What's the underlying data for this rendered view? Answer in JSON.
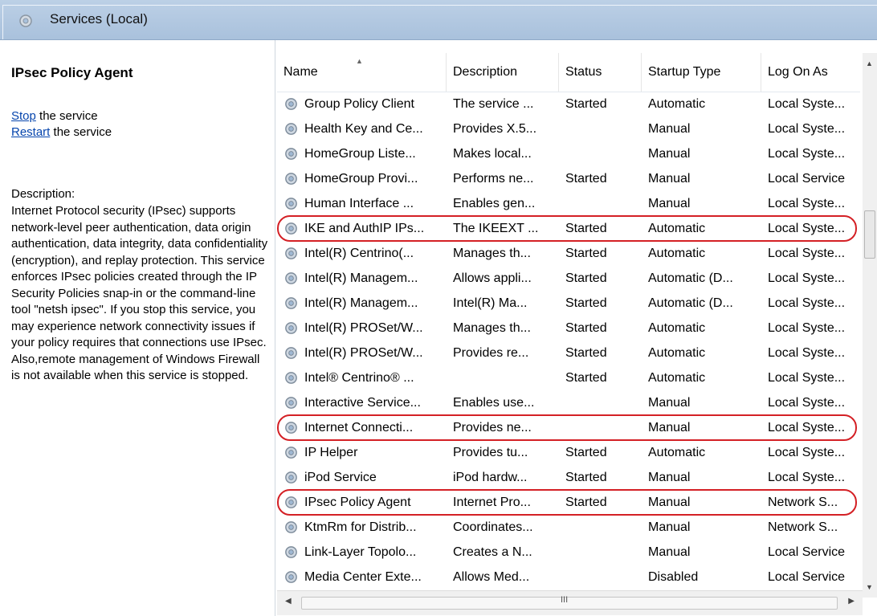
{
  "header": {
    "title": "Services (Local)",
    "icon": "gear-icon"
  },
  "left_panel": {
    "service_name": "IPsec Policy Agent",
    "stop_link": "Stop",
    "stop_suffix": " the service",
    "restart_link": "Restart",
    "restart_suffix": " the service",
    "description_label": "Description:",
    "description": "Internet Protocol security (IPsec) supports network-level peer authentication, data origin authentication, data integrity, data confidentiality (encryption), and replay protection.  This service enforces IPsec policies created through the IP Security Policies snap-in or the command-line tool \"netsh ipsec\".  If you stop this service, you may experience network connectivity issues if your policy requires that connections use IPsec.  Also,remote management of Windows Firewall is not available when this service is stopped."
  },
  "columns": [
    "Name",
    "Description",
    "Status",
    "Startup Type",
    "Log On As"
  ],
  "rows": [
    {
      "name": "Group Policy Client",
      "description": "The service ...",
      "status": "Started",
      "startup": "Automatic",
      "logon": "Local Syste...",
      "highlighted": false
    },
    {
      "name": "Health Key and Ce...",
      "description": "Provides X.5...",
      "status": "",
      "startup": "Manual",
      "logon": "Local Syste...",
      "highlighted": false
    },
    {
      "name": "HomeGroup Liste...",
      "description": "Makes local...",
      "status": "",
      "startup": "Manual",
      "logon": "Local Syste...",
      "highlighted": false
    },
    {
      "name": "HomeGroup Provi...",
      "description": "Performs ne...",
      "status": "Started",
      "startup": "Manual",
      "logon": "Local Service",
      "highlighted": false
    },
    {
      "name": "Human Interface ...",
      "description": "Enables gen...",
      "status": "",
      "startup": "Manual",
      "logon": "Local Syste...",
      "highlighted": false
    },
    {
      "name": "IKE and AuthIP IPs...",
      "description": "The IKEEXT ...",
      "status": "Started",
      "startup": "Automatic",
      "logon": "Local Syste...",
      "highlighted": true
    },
    {
      "name": "Intel(R) Centrino(...",
      "description": "Manages th...",
      "status": "Started",
      "startup": "Automatic",
      "logon": "Local Syste...",
      "highlighted": false
    },
    {
      "name": "Intel(R) Managem...",
      "description": "Allows appli...",
      "status": "Started",
      "startup": "Automatic (D...",
      "logon": "Local Syste...",
      "highlighted": false
    },
    {
      "name": "Intel(R) Managem...",
      "description": "Intel(R) Ma...",
      "status": "Started",
      "startup": "Automatic (D...",
      "logon": "Local Syste...",
      "highlighted": false
    },
    {
      "name": "Intel(R) PROSet/W...",
      "description": "Manages th...",
      "status": "Started",
      "startup": "Automatic",
      "logon": "Local Syste...",
      "highlighted": false
    },
    {
      "name": "Intel(R) PROSet/W...",
      "description": "Provides re...",
      "status": "Started",
      "startup": "Automatic",
      "logon": "Local Syste...",
      "highlighted": false
    },
    {
      "name": "Intel® Centrino® ...",
      "description": "",
      "status": "Started",
      "startup": "Automatic",
      "logon": "Local Syste...",
      "highlighted": false
    },
    {
      "name": "Interactive Service...",
      "description": "Enables use...",
      "status": "",
      "startup": "Manual",
      "logon": "Local Syste...",
      "highlighted": false
    },
    {
      "name": "Internet Connecti...",
      "description": "Provides ne...",
      "status": "",
      "startup": "Manual",
      "logon": "Local Syste...",
      "highlighted": true
    },
    {
      "name": "IP Helper",
      "description": "Provides tu...",
      "status": "Started",
      "startup": "Automatic",
      "logon": "Local Syste...",
      "highlighted": false
    },
    {
      "name": "iPod Service",
      "description": "iPod hardw...",
      "status": "Started",
      "startup": "Manual",
      "logon": "Local Syste...",
      "highlighted": false
    },
    {
      "name": "IPsec Policy Agent",
      "description": "Internet Pro...",
      "status": "Started",
      "startup": "Manual",
      "logon": "Network S...",
      "highlighted": true
    },
    {
      "name": "KtmRm for Distrib...",
      "description": "Coordinates...",
      "status": "",
      "startup": "Manual",
      "logon": "Network S...",
      "highlighted": false
    },
    {
      "name": "Link-Layer Topolo...",
      "description": "Creates a N...",
      "status": "",
      "startup": "Manual",
      "logon": "Local Service",
      "highlighted": false
    },
    {
      "name": "Media Center Exte...",
      "description": "Allows Med...",
      "status": "",
      "startup": "Disabled",
      "logon": "Local Service",
      "highlighted": false
    }
  ],
  "colors": {
    "header_bg": "#bcd0e6",
    "link": "#0645ad",
    "highlight_outline": "#d42025"
  }
}
